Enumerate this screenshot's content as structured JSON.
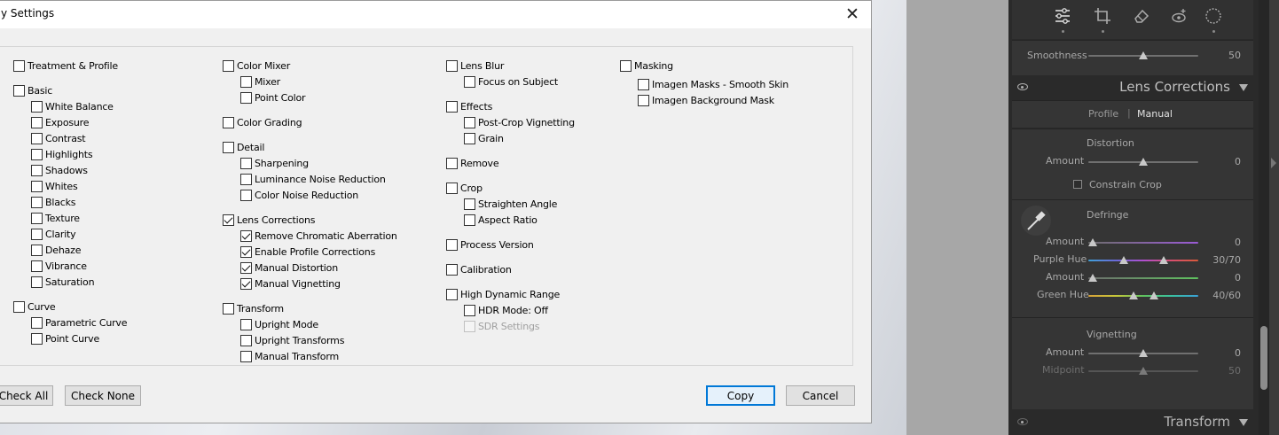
{
  "dialog": {
    "title": "y Settings",
    "close_glyph": "✕",
    "buttons": {
      "check_all": "Check All",
      "check_none": "Check None",
      "copy": "Copy",
      "cancel": "Cancel"
    },
    "col1": [
      {
        "label": "Treatment & Profile",
        "checked": false,
        "level": 0
      },
      {
        "label": "Basic",
        "checked": false,
        "level": 0
      },
      {
        "label": "White Balance",
        "checked": false,
        "level": 1
      },
      {
        "label": "Exposure",
        "checked": false,
        "level": 1
      },
      {
        "label": "Contrast",
        "checked": false,
        "level": 1
      },
      {
        "label": "Highlights",
        "checked": false,
        "level": 1
      },
      {
        "label": "Shadows",
        "checked": false,
        "level": 1
      },
      {
        "label": "Whites",
        "checked": false,
        "level": 1
      },
      {
        "label": "Blacks",
        "checked": false,
        "level": 1
      },
      {
        "label": "Texture",
        "checked": false,
        "level": 1
      },
      {
        "label": "Clarity",
        "checked": false,
        "level": 1
      },
      {
        "label": "Dehaze",
        "checked": false,
        "level": 1
      },
      {
        "label": "Vibrance",
        "checked": false,
        "level": 1
      },
      {
        "label": "Saturation",
        "checked": false,
        "level": 1
      },
      {
        "label": "Curve",
        "checked": false,
        "level": 0
      },
      {
        "label": "Parametric Curve",
        "checked": false,
        "level": 1
      },
      {
        "label": "Point Curve",
        "checked": false,
        "level": 1
      }
    ],
    "col2": [
      {
        "label": "Color Mixer",
        "checked": false,
        "level": 0
      },
      {
        "label": "Mixer",
        "checked": false,
        "level": 1
      },
      {
        "label": "Point Color",
        "checked": false,
        "level": 1
      },
      {
        "label": "Color Grading",
        "checked": false,
        "level": 0
      },
      {
        "label": "Detail",
        "checked": false,
        "level": 0
      },
      {
        "label": "Sharpening",
        "checked": false,
        "level": 1
      },
      {
        "label": "Luminance Noise Reduction",
        "checked": false,
        "level": 1
      },
      {
        "label": "Color Noise Reduction",
        "checked": false,
        "level": 1
      },
      {
        "label": "Lens Corrections",
        "checked": true,
        "level": 0
      },
      {
        "label": "Remove Chromatic Aberration",
        "checked": true,
        "level": 1
      },
      {
        "label": "Enable Profile Corrections",
        "checked": true,
        "level": 1
      },
      {
        "label": "Manual Distortion",
        "checked": true,
        "level": 1
      },
      {
        "label": "Manual Vignetting",
        "checked": true,
        "level": 1
      },
      {
        "label": "Transform",
        "checked": false,
        "level": 0
      },
      {
        "label": "Upright Mode",
        "checked": false,
        "level": 1
      },
      {
        "label": "Upright Transforms",
        "checked": false,
        "level": 1
      },
      {
        "label": "Manual Transform",
        "checked": false,
        "level": 1
      }
    ],
    "col3": [
      {
        "label": "Lens Blur",
        "checked": false,
        "level": 0
      },
      {
        "label": "Focus on Subject",
        "checked": false,
        "level": 1
      },
      {
        "label": "Effects",
        "checked": false,
        "level": 0
      },
      {
        "label": "Post-Crop Vignetting",
        "checked": false,
        "level": 1
      },
      {
        "label": "Grain",
        "checked": false,
        "level": 1
      },
      {
        "label": "Remove",
        "checked": false,
        "level": 0
      },
      {
        "label": "Crop",
        "checked": false,
        "level": 0
      },
      {
        "label": "Straighten Angle",
        "checked": false,
        "level": 1
      },
      {
        "label": "Aspect Ratio",
        "checked": false,
        "level": 1
      },
      {
        "label": "Process Version",
        "checked": false,
        "level": 0
      },
      {
        "label": "Calibration",
        "checked": false,
        "level": 0
      },
      {
        "label": "High Dynamic Range",
        "checked": false,
        "level": 0
      },
      {
        "label": "HDR Mode: Off",
        "checked": false,
        "level": 1
      },
      {
        "label": "SDR Settings",
        "checked": false,
        "level": 1,
        "disabled": true
      }
    ],
    "col4": [
      {
        "label": "Masking",
        "checked": false,
        "level": 0
      },
      {
        "label": "Imagen Masks - Smooth Skin",
        "checked": false,
        "level": 1
      },
      {
        "label": "Imagen Background Mask",
        "checked": false,
        "level": 1
      }
    ]
  },
  "panel": {
    "tools": [
      "sliders-icon",
      "crop-icon",
      "eraser-icon",
      "redeye-icon",
      "masking-icon"
    ],
    "smoothness": {
      "label": "Smoothness",
      "value": "50",
      "fraction": 0.5
    },
    "lens_corrections": {
      "title": "Lens Corrections",
      "tab_profile": "Profile",
      "tab_separator": "|",
      "tab_manual": "Manual",
      "distortion": {
        "heading": "Distortion",
        "amount_label": "Amount",
        "amount_value": "0",
        "fraction": 0.5
      },
      "constrain_crop": "Constrain Crop",
      "defringe": {
        "heading": "Defringe",
        "purple_amount_label": "Amount",
        "purple_amount_value": "0",
        "purple_hue_label": "Purple Hue",
        "purple_hue_value": "30/70",
        "green_amount_label": "Amount",
        "green_amount_value": "0",
        "green_hue_label": "Green Hue",
        "green_hue_value": "40/60"
      },
      "vignetting": {
        "heading": "Vignetting",
        "amount_label": "Amount",
        "amount_value": "0",
        "midpoint_label": "Midpoint",
        "midpoint_value": "50"
      }
    },
    "transform": {
      "title": "Transform"
    }
  },
  "colors": {
    "accent": "#0078d7",
    "purple_hue": "#9b5bd6",
    "green_hue": "#5fc25f"
  }
}
